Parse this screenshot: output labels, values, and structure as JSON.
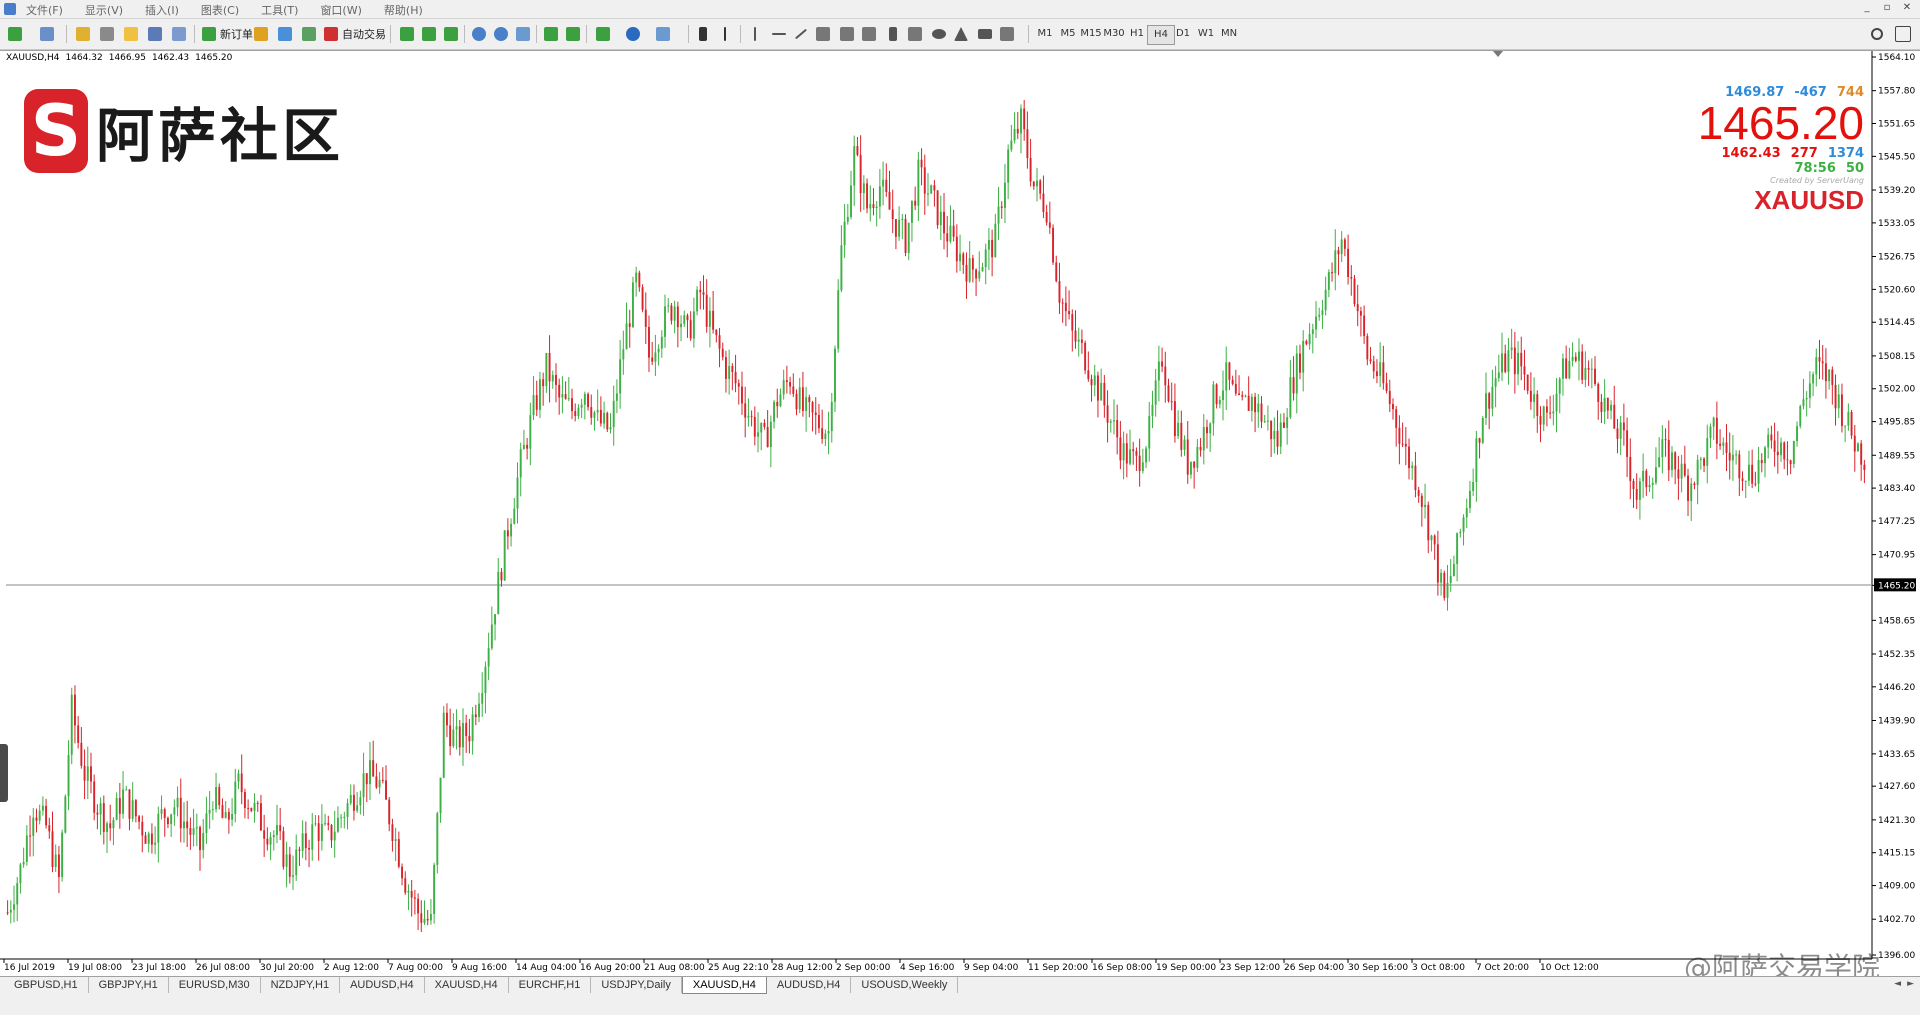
{
  "menubar": {
    "items": [
      "文件(F)",
      "显示(V)",
      "插入(I)",
      "图表(C)",
      "工具(T)",
      "窗口(W)",
      "帮助(H)"
    ],
    "window_controls": [
      "_",
      "▫",
      "✕"
    ]
  },
  "toolbar": {
    "new_order_label": "新订单",
    "auto_trading_label": "自动交易",
    "timeframes": [
      "M1",
      "M5",
      "M15",
      "M30",
      "H1",
      "H4",
      "D1",
      "W1",
      "MN"
    ],
    "active_timeframe": "H4"
  },
  "chart": {
    "header": {
      "symbol_tf": "XAUUSD,H4",
      "open": "1464.32",
      "high": "1466.95",
      "low": "1462.43",
      "close": "1465.20"
    },
    "current_price_label": "1465.20",
    "y_labels": [
      "1564.10",
      "1557.80",
      "1551.65",
      "1545.50",
      "1539.20",
      "1533.05",
      "1526.75",
      "1520.60",
      "1514.45",
      "1508.15",
      "1502.00",
      "1495.85",
      "1489.55",
      "1483.40",
      "1477.25",
      "1470.95",
      "1465.20",
      "1458.65",
      "1452.35",
      "1446.20",
      "1439.90",
      "1433.65",
      "1427.60",
      "1421.30",
      "1415.15",
      "1409.00",
      "1402.70",
      "1396.00"
    ],
    "x_labels": [
      "16 Jul 2019",
      "19 Jul 08:00",
      "23 Jul 18:00",
      "26 Jul 08:00",
      "30 Jul 20:00",
      "2 Aug 12:00",
      "7 Aug 00:00",
      "9 Aug 16:00",
      "14 Aug 04:00",
      "16 Aug 20:00",
      "21 Aug 08:00",
      "25 Aug 22:10",
      "28 Aug 12:00",
      "2 Sep 00:00",
      "4 Sep 16:00",
      "9 Sep 04:00",
      "11 Sep 20:00",
      "16 Sep 08:00",
      "19 Sep 00:00",
      "23 Sep 12:00",
      "26 Sep 04:00",
      "30 Sep 16:00",
      "3 Oct 08:00",
      "7 Oct 20:00",
      "10 Oct 12:00"
    ]
  },
  "logo": {
    "mark": "S",
    "text": "阿萨社区"
  },
  "info_panel": {
    "row1": [
      "1469.87",
      "-467",
      "744"
    ],
    "price": "1465.20",
    "row2": [
      "1462.43",
      "277",
      "1374"
    ],
    "row3": [
      "78:56",
      "50"
    ],
    "credit": "Created by ServerUang",
    "symbol": "XAUUSD"
  },
  "colors": {
    "bull": "#3cb043",
    "bear": "#d8232a",
    "info_blue": "#2f8ad8",
    "info_orange": "#e08a2c",
    "info_red": "#e3100b",
    "info_green": "#3cb043"
  },
  "tabs": {
    "items": [
      "GBPUSD,H1",
      "GBPJPY,H1",
      "EURUSD,M30",
      "NZDJPY,H1",
      "AUDUSD,H4",
      "XAUUSD,H4",
      "EURCHF,H1",
      "USDJPY,Daily",
      "XAUUSD,H4",
      "AUDUSD,H4",
      "USOUSD,Weekly"
    ],
    "active_index": 8
  },
  "watermark": "@阿萨交易学院",
  "chart_data": {
    "type": "candlestick",
    "symbol": "XAUUSD",
    "timeframe": "H4",
    "ylim": [
      1396.0,
      1564.1
    ],
    "current_price": 1465.2,
    "segments": [
      [
        1404,
        1412,
        1424,
        1420,
        1410
      ],
      [
        1410,
        1442,
        1430,
        1424,
        1420,
        1426,
        1422,
        1418,
        1422,
        1424,
        1420,
        1416
      ],
      [
        1416,
        1426,
        1420,
        1428,
        1424,
        1420
      ],
      [
        1420,
        1418,
        1412,
        1416,
        1420,
        1418,
        1422,
        1426,
        1430,
        1428
      ],
      [
        1428,
        1420,
        1410,
        1404,
        1402
      ],
      [
        1402,
        1440,
        1436,
        1438,
        1448,
        1462
      ],
      [
        1462,
        1476,
        1488,
        1498,
        1506
      ],
      [
        1506,
        1500,
        1498,
        1502,
        1496,
        1494
      ],
      [
        1494,
        1510,
        1522,
        1508,
        1514,
        1518,
        1512,
        1520
      ],
      [
        1520,
        1512,
        1506,
        1502,
        1496,
        1492
      ],
      [
        1492,
        1500,
        1504,
        1498,
        1496,
        1494
      ],
      [
        1494,
        1528,
        1546,
        1536,
        1540,
        1534,
        1530
      ],
      [
        1530,
        1542,
        1538,
        1532,
        1528,
        1524,
        1526,
        1530
      ],
      [
        1530,
        1546,
        1552,
        1540,
        1536,
        1520,
        1512
      ],
      [
        1512,
        1508,
        1502,
        1496,
        1490,
        1488
      ],
      [
        1488,
        1494,
        1508,
        1496,
        1488,
        1492
      ],
      [
        1492,
        1500,
        1504,
        1498,
        1500,
        1496
      ],
      [
        1496,
        1492,
        1502,
        1510,
        1516,
        1522
      ],
      [
        1522,
        1530,
        1520,
        1508,
        1504,
        1498
      ],
      [
        1498,
        1490,
        1484,
        1474,
        1462,
        1472,
        1484
      ],
      [
        1484,
        1498,
        1504,
        1508,
        1506,
        1500,
        1496
      ],
      [
        1496,
        1504,
        1508,
        1506,
        1502,
        1496,
        1492
      ],
      [
        1492,
        1482,
        1486,
        1490,
        1488,
        1484,
        1488
      ],
      [
        1488,
        1494,
        1490,
        1488,
        1486,
        1490,
        1492,
        1490
      ],
      [
        1490,
        1500,
        1506,
        1504,
        1498,
        1492,
        1488
      ]
    ]
  }
}
